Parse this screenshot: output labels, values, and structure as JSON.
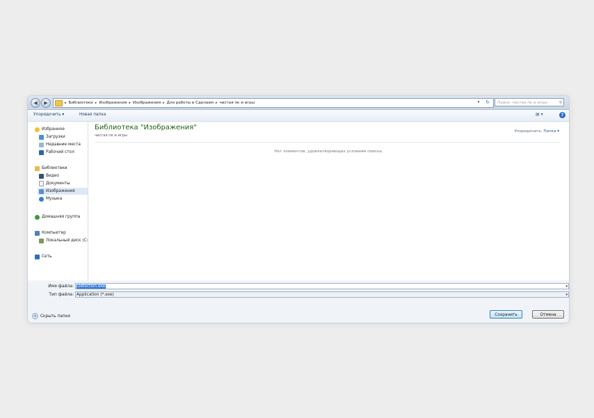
{
  "address_bar": {
    "breadcrumbs": [
      "Библиотеки",
      "Изображения",
      "Изображения",
      "Для работы в Сделаем",
      "чистая пк и игры"
    ],
    "search_placeholder": "Поиск: чистая пк и игры"
  },
  "toolbar": {
    "organize_label": "Упорядочить ▾",
    "new_folder_label": "Новая папка"
  },
  "nav": {
    "favorites": {
      "label": "Избранное",
      "items": [
        "Загрузки",
        "Недавние места",
        "Рабочий стол"
      ]
    },
    "libraries": {
      "label": "Библиотеки",
      "items": [
        "Видео",
        "Документы",
        "Изображения",
        "Музыка"
      ],
      "selected": "Изображения"
    },
    "homegroup": "Домашняя группа",
    "computer": {
      "label": "Компьютер",
      "items": [
        "Локальный диск (C:"
      ]
    },
    "network": "Сеть"
  },
  "content": {
    "library_title": "Библиотека \"Изображения\"",
    "library_subtitle": "чистая пк и игры",
    "arrange_label": "Упорядочить:",
    "arrange_value": "Папка ▾",
    "empty_message": "Нет элементов, удовлетворяющих условиям поиска."
  },
  "bottom": {
    "filename_label": "Имя файла:",
    "filename_value": "Detection.exe",
    "filetype_label": "Тип файла:",
    "filetype_value": "Application (*.exe)",
    "hide_folders_label": "Скрыть папки",
    "save_label": "Сохранить",
    "cancel_label": "Отмена"
  },
  "colors": {
    "library_title": "#1f5f0e",
    "selection": "#3077d6",
    "accent": "#2a6bd0"
  }
}
